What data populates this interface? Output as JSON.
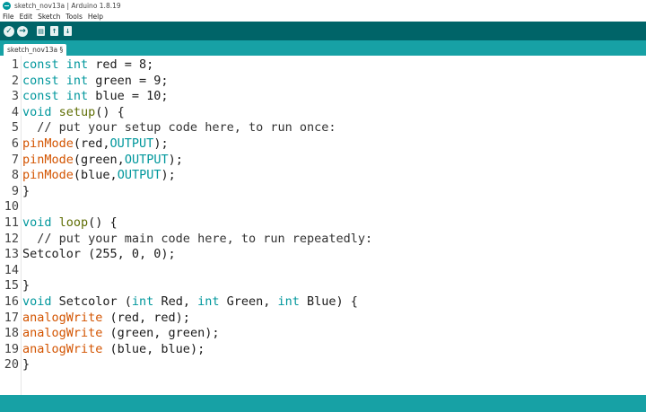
{
  "window": {
    "title": "sketch_nov13a | Arduino 1.8.19"
  },
  "menu": [
    "File",
    "Edit",
    "Sketch",
    "Tools",
    "Help"
  ],
  "toolbar": {
    "verify_glyph": "✓",
    "upload_glyph": "→",
    "new_glyph": "▤",
    "open_glyph": "↑",
    "save_glyph": "↓"
  },
  "tab": {
    "label": "sketch_nov13a §"
  },
  "colors": {
    "toolbar": "#006468",
    "tabstrip": "#17a1a5",
    "keyword": "#00979c",
    "function": "#d35400"
  },
  "code_lines": [
    [
      {
        "t": "const int",
        "c": "kw"
      },
      {
        "t": " red = 8;"
      }
    ],
    [
      {
        "t": "const int",
        "c": "kw"
      },
      {
        "t": " green = 9;"
      }
    ],
    [
      {
        "t": "const int",
        "c": "kw"
      },
      {
        "t": " blue = 10;"
      }
    ],
    [
      {
        "t": "void",
        "c": "kw"
      },
      {
        "t": " "
      },
      {
        "t": "setup",
        "c": "user"
      },
      {
        "t": "() {"
      }
    ],
    [
      {
        "t": "  // put your setup code here, to run once:",
        "c": "cmt"
      }
    ],
    [
      {
        "t": "pinMode",
        "c": "fn"
      },
      {
        "t": "(red,"
      },
      {
        "t": "OUTPUT",
        "c": "const"
      },
      {
        "t": ");"
      }
    ],
    [
      {
        "t": "pinMode",
        "c": "fn"
      },
      {
        "t": "(green,"
      },
      {
        "t": "OUTPUT",
        "c": "const"
      },
      {
        "t": ");"
      }
    ],
    [
      {
        "t": "pinMode",
        "c": "fn"
      },
      {
        "t": "(blue,"
      },
      {
        "t": "OUTPUT",
        "c": "const"
      },
      {
        "t": ");"
      }
    ],
    [
      {
        "t": "}"
      }
    ],
    [],
    [
      {
        "t": "void",
        "c": "kw"
      },
      {
        "t": " "
      },
      {
        "t": "loop",
        "c": "user"
      },
      {
        "t": "() {"
      }
    ],
    [
      {
        "t": "  // put your main code here, to run repeatedly:",
        "c": "cmt"
      }
    ],
    [
      {
        "t": "Setcolor (255, 0, 0);"
      }
    ],
    [],
    [
      {
        "t": "}"
      }
    ],
    [
      {
        "t": "void",
        "c": "kw"
      },
      {
        "t": " Setcolor ("
      },
      {
        "t": "int",
        "c": "kw"
      },
      {
        "t": " Red, "
      },
      {
        "t": "int",
        "c": "kw"
      },
      {
        "t": " Green, "
      },
      {
        "t": "int",
        "c": "kw"
      },
      {
        "t": " Blue) {"
      }
    ],
    [
      {
        "t": "analogWrite",
        "c": "fn"
      },
      {
        "t": " (red, red);"
      }
    ],
    [
      {
        "t": "analogWrite",
        "c": "fn"
      },
      {
        "t": " (green, green);"
      }
    ],
    [
      {
        "t": "analogWrite",
        "c": "fn"
      },
      {
        "t": " (blue, blue);"
      }
    ],
    [
      {
        "t": "}"
      }
    ]
  ]
}
